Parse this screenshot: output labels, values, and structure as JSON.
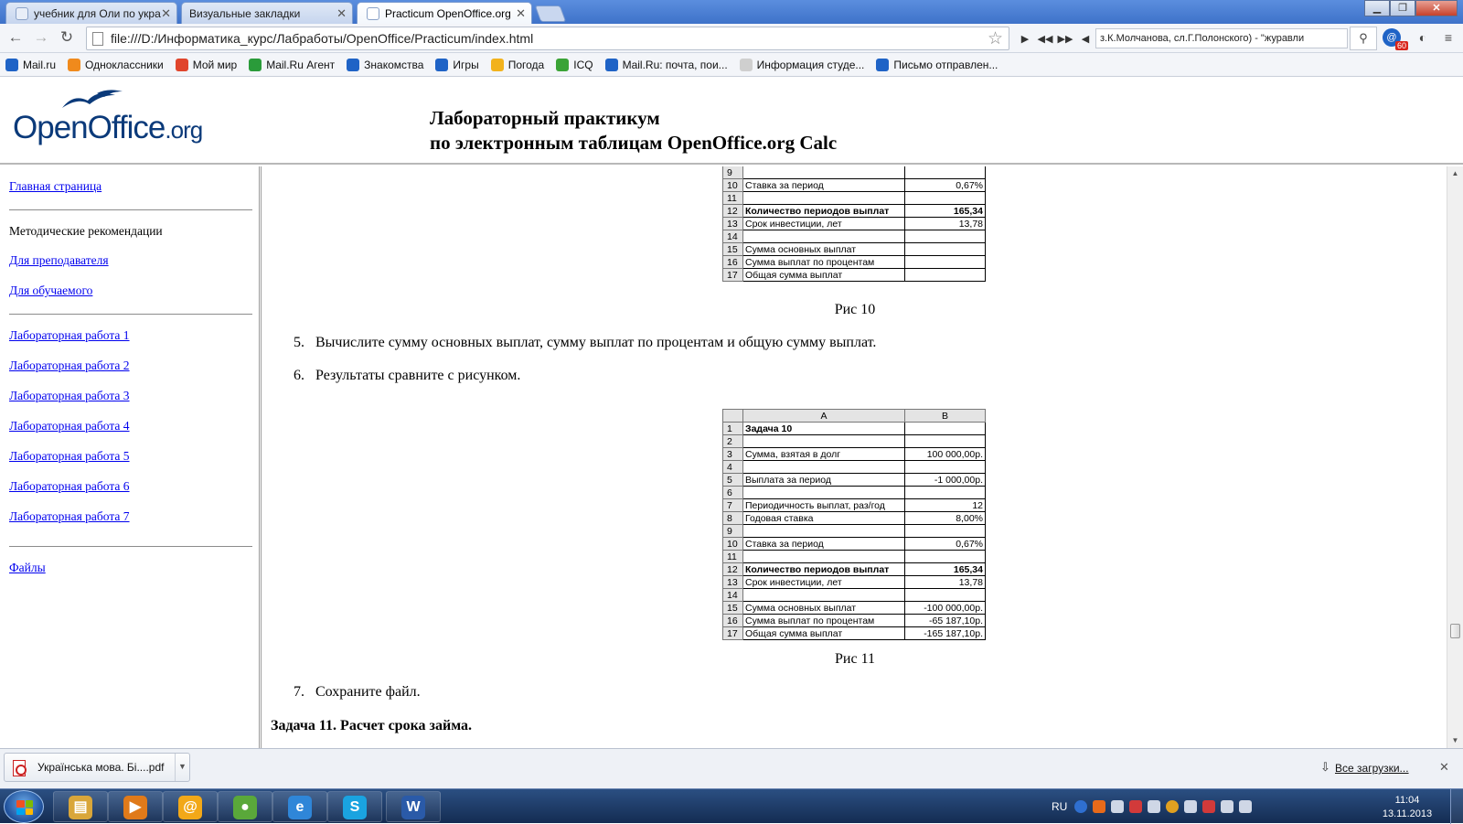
{
  "browser": {
    "tabs": [
      {
        "label": "учебник для Оли по укра",
        "active": false
      },
      {
        "label": "Визуальные закладки",
        "active": false
      },
      {
        "label": "Practicum OpenOffice.org",
        "active": true
      }
    ],
    "url": "file:///D:/Информатика_курс/Лабработы/OpenOffice/Practicum/index.html",
    "player_text": "з.К.Молчанова, сл.Г.Полонского) - \"журавли",
    "mail_badge_count": "60",
    "bookmarks": [
      {
        "label": "Mail.ru",
        "icon": "mailru-icon",
        "color": "#1f63c6"
      },
      {
        "label": "Одноклассники",
        "icon": "odnoklassniki-icon",
        "color": "#f08a1c"
      },
      {
        "label": "Мой мир",
        "icon": "moymir-icon",
        "color": "#e0452c"
      },
      {
        "label": "Mail.Ru Агент",
        "icon": "agent-icon",
        "color": "#2a9b3a"
      },
      {
        "label": "Знакомства",
        "icon": "at-icon",
        "color": "#1f63c6"
      },
      {
        "label": "Игры",
        "icon": "games-icon",
        "color": "#1f63c6"
      },
      {
        "label": "Погода",
        "icon": "weather-icon",
        "color": "#f2b21c"
      },
      {
        "label": "ICQ",
        "icon": "icq-icon",
        "color": "#3aa336"
      },
      {
        "label": "Mail.Ru: почта, пои...",
        "icon": "mailru-icon",
        "color": "#1f63c6"
      },
      {
        "label": "Информация студе...",
        "icon": "page-icon",
        "color": "#cfcfcf"
      },
      {
        "label": "Письмо отправлен...",
        "icon": "mailru-icon",
        "color": "#1f63c6"
      }
    ]
  },
  "header": {
    "logo_word": "OpenOffice",
    "logo_suffix": ".org",
    "title_line1": "Лабораторный практикум",
    "title_line2": "по электронным таблицам OpenOffice.org Calc"
  },
  "sidebar": {
    "home": "Главная страница",
    "method_heading": "Методические рекомендации",
    "for_teacher": "Для преподавателя",
    "for_student": "Для обучаемого",
    "labs": [
      "Лабораторная работа 1",
      "Лабораторная работа 2",
      "Лабораторная работа 3",
      "Лабораторная работа 4",
      "Лабораторная работа 5",
      "Лабораторная работа 6",
      "Лабораторная работа 7"
    ],
    "files": "Файлы"
  },
  "content": {
    "fig10": {
      "caption": "Рис 10",
      "rows": [
        {
          "n": "9",
          "a": "",
          "b": "",
          "bold": false
        },
        {
          "n": "10",
          "a": "Ставка за период",
          "b": "0,67%",
          "bold": false
        },
        {
          "n": "11",
          "a": "",
          "b": "",
          "bold": false
        },
        {
          "n": "12",
          "a": "Количество периодов выплат",
          "b": "165,34",
          "bold": true
        },
        {
          "n": "13",
          "a": "Срок инвестиции, лет",
          "b": "13,78",
          "bold": false
        },
        {
          "n": "14",
          "a": "",
          "b": "",
          "bold": false
        },
        {
          "n": "15",
          "a": "Сумма основных выплат",
          "b": "",
          "bold": false
        },
        {
          "n": "16",
          "a": "Сумма выплат по процентам",
          "b": "",
          "bold": false
        },
        {
          "n": "17",
          "a": "Общая сумма  выплат",
          "b": "",
          "bold": false
        }
      ]
    },
    "step5": {
      "num": "5.",
      "text": "Вычислите сумму основных выплат, сумму выплат по процентам и общую сумму выплат."
    },
    "step6": {
      "num": "6.",
      "text": "Результаты сравните с рисунком."
    },
    "fig11": {
      "caption": "Рис 11",
      "col_a": "A",
      "col_b": "B",
      "rows": [
        {
          "n": "1",
          "a": "Задача 10",
          "b": "",
          "bold": true
        },
        {
          "n": "2",
          "a": "",
          "b": "",
          "bold": false
        },
        {
          "n": "3",
          "a": "Сумма, взятая в долг",
          "b": "100 000,00р.",
          "bold": false
        },
        {
          "n": "4",
          "a": "",
          "b": "",
          "bold": false
        },
        {
          "n": "5",
          "a": "Выплата за период",
          "b": "-1 000,00р.",
          "bold": false
        },
        {
          "n": "6",
          "a": "",
          "b": "",
          "bold": false
        },
        {
          "n": "7",
          "a": "Периодичность выплат, раз/год",
          "b": "12",
          "bold": false
        },
        {
          "n": "8",
          "a": "Годовая ставка",
          "b": "8,00%",
          "bold": false
        },
        {
          "n": "9",
          "a": "",
          "b": "",
          "bold": false
        },
        {
          "n": "10",
          "a": "Ставка за период",
          "b": "0,67%",
          "bold": false
        },
        {
          "n": "11",
          "a": "",
          "b": "",
          "bold": false
        },
        {
          "n": "12",
          "a": "Количество периодов выплат",
          "b": "165,34",
          "bold": true
        },
        {
          "n": "13",
          "a": "Срок инвестиции, лет",
          "b": "13,78",
          "bold": false
        },
        {
          "n": "14",
          "a": "",
          "b": "",
          "bold": false
        },
        {
          "n": "15",
          "a": "Сумма основных выплат",
          "b": "-100 000,00р.",
          "bold": false
        },
        {
          "n": "16",
          "a": "Сумма выплат по процентам",
          "b": "-65 187,10р.",
          "bold": false
        },
        {
          "n": "17",
          "a": "Общая сумма  выплат",
          "b": "-165 187,10р.",
          "bold": false
        }
      ]
    },
    "step7": {
      "num": "7.",
      "text": "Сохраните файл."
    },
    "task11": "Задача 11. Расчет срока займа."
  },
  "downloads": {
    "file": "Українська мова. Бі....pdf",
    "show_all": "Все загрузки..."
  },
  "taskbar": {
    "lang": "RU",
    "time": "11:04",
    "date": "13.11.2013",
    "apps": [
      {
        "name": "explorer-icon",
        "color": "#d9a63a",
        "glyph": "▤"
      },
      {
        "name": "media-player-icon",
        "color": "#e07a1a",
        "glyph": "▶"
      },
      {
        "name": "mail-agent-icon",
        "color": "#f2a818",
        "glyph": "@"
      },
      {
        "name": "chrome-icon",
        "color": "#5aa83a",
        "glyph": "●"
      },
      {
        "name": "ie-icon",
        "color": "#2f86d8",
        "glyph": "e"
      },
      {
        "name": "skype-icon",
        "color": "#1aa3e0",
        "glyph": "S"
      },
      {
        "name": "word-icon",
        "color": "#2a5aa8",
        "glyph": "W"
      }
    ]
  }
}
